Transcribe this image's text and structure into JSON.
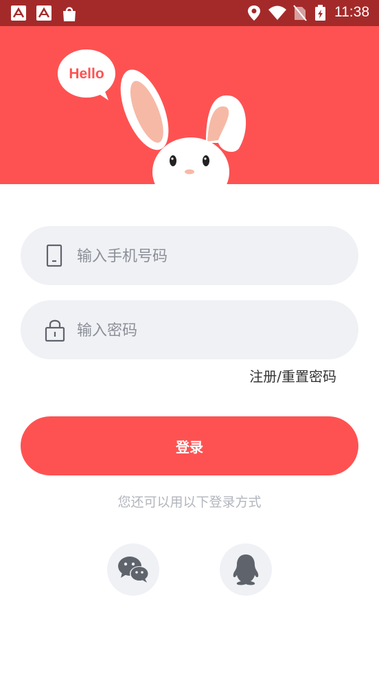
{
  "status_bar": {
    "time": "11:38",
    "left_icons": [
      "app-notification-icon",
      "app-notification-icon",
      "shopping-bag-icon"
    ],
    "right_icons": [
      "location-icon",
      "wifi-icon",
      "no-sim-icon",
      "battery-charging-icon"
    ]
  },
  "banner": {
    "bubble_text": "Hello",
    "colors": {
      "background": "#fe5252",
      "bubble": "#ffffff"
    }
  },
  "form": {
    "phone": {
      "placeholder": "输入手机号码",
      "value": "",
      "icon": "phone-icon"
    },
    "password": {
      "placeholder": "输入密码",
      "value": "",
      "icon": "lock-icon"
    },
    "register_link": "注册/重置密码",
    "login_label": "登录"
  },
  "alt_login": {
    "text": "您还可以用以下登录方式",
    "providers": [
      {
        "icon": "wechat-icon"
      },
      {
        "icon": "qq-icon"
      }
    ]
  },
  "colors": {
    "accent": "#fe5252",
    "status_bar": "#a42a2a",
    "field_bg": "#eff1f5",
    "muted_text": "#b2b5bc"
  }
}
